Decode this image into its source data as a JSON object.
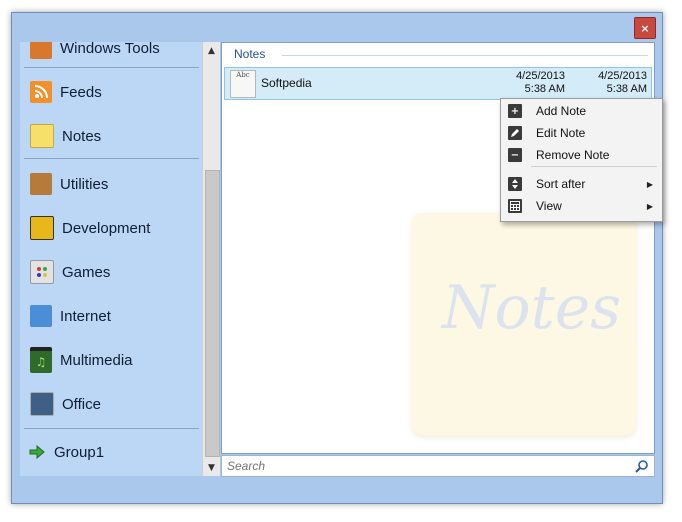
{
  "sidebar": {
    "items": [
      {
        "label": "Windows Tools",
        "icon": "windows-tools-icon"
      },
      {
        "label": "Feeds",
        "icon": "rss-feed-icon"
      },
      {
        "label": "Notes",
        "icon": "notes-icon"
      },
      {
        "label": "Utilities",
        "icon": "utilities-icon"
      },
      {
        "label": "Development",
        "icon": "construction-icon"
      },
      {
        "label": "Games",
        "icon": "games-icon"
      },
      {
        "label": "Internet",
        "icon": "internet-icon"
      },
      {
        "label": "Multimedia",
        "icon": "multimedia-icon"
      },
      {
        "label": "Office",
        "icon": "office-icon"
      },
      {
        "label": "Group1",
        "icon": "green-arrow-icon"
      }
    ]
  },
  "main": {
    "section_title": "Notes",
    "note": {
      "icon_text": "Abc",
      "title": "Softpedia",
      "created_date": "4/25/2013",
      "created_time": "5:38 AM",
      "modified_date": "4/25/2013",
      "modified_time": "5:38 AM"
    },
    "watermark_text": "Notes"
  },
  "search": {
    "placeholder": "Search"
  },
  "context_menu": {
    "items": [
      {
        "label": "Add Note",
        "icon": "plus-icon"
      },
      {
        "label": "Edit Note",
        "icon": "pencil-icon"
      },
      {
        "label": "Remove Note",
        "icon": "minus-icon"
      },
      {
        "label": "Sort after",
        "icon": "sort-icon",
        "submenu": true
      },
      {
        "label": "View",
        "icon": "view-grid-icon",
        "submenu": true
      }
    ]
  },
  "window": {
    "close_label": "×"
  }
}
